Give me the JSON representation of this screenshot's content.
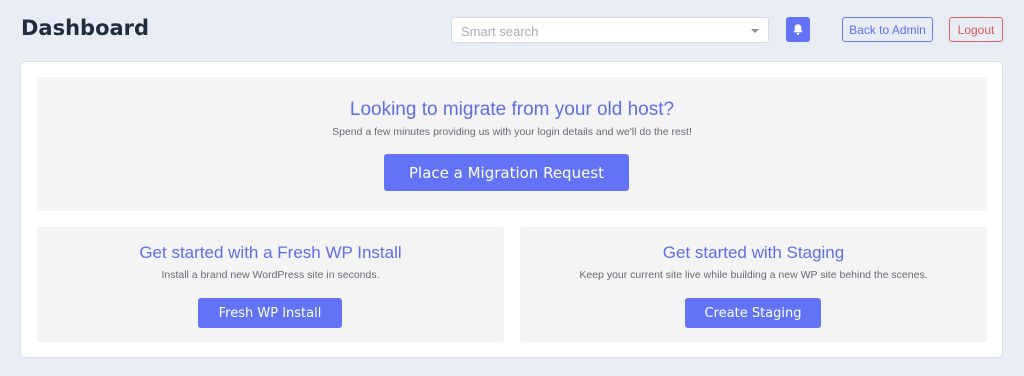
{
  "header": {
    "title": "Dashboard",
    "search_placeholder": "Smart search",
    "notifications_icon": "bell-icon",
    "back_to_admin_label": "Back to Admin",
    "logout_label": "Logout"
  },
  "colors": {
    "accent": "#6274f5",
    "danger": "#e0545d",
    "background": "#e8ecf5",
    "panel": "#f4f4f4"
  },
  "migration": {
    "heading": "Looking to migrate from your old host?",
    "description": "Spend a few minutes providing us with your login details and we'll do the rest!",
    "button_label": "Place a Migration Request"
  },
  "fresh_install": {
    "heading": "Get started with a Fresh WP Install",
    "description": "Install a brand new WordPress site in seconds.",
    "button_label": "Fresh WP Install"
  },
  "staging": {
    "heading": "Get started with Staging",
    "description": "Keep your current site live while building a new WP site behind the scenes.",
    "button_label": "Create Staging"
  }
}
